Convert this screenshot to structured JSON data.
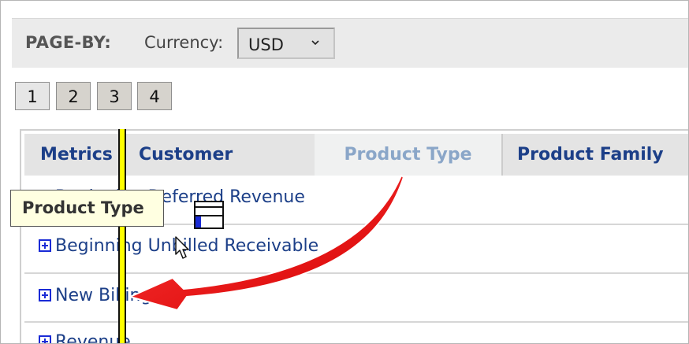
{
  "pageby": {
    "label": "PAGE-BY:",
    "currency_label": "Currency:",
    "currency_value": "USD"
  },
  "pages": [
    "1",
    "2",
    "3",
    "4"
  ],
  "header": {
    "metrics": "Metrics",
    "customer": "Customer",
    "product_type": "Product Type",
    "product_family": "Product Family"
  },
  "rows": [
    "Beginning Deferred Revenue",
    "Beginning Unbilled Receivable",
    "New Billings",
    "Revenue"
  ],
  "drag": {
    "tooltip": "Product Type"
  },
  "colors": {
    "drop_indicator": "#ffff00",
    "arrow": "#ee1111",
    "header_text": "#1c3f88"
  },
  "icons": {
    "expand": "plus-square-icon",
    "drag": "table-drag-icon",
    "pointer": "mouse-pointer-icon",
    "chevron": "chevron-down-icon"
  }
}
